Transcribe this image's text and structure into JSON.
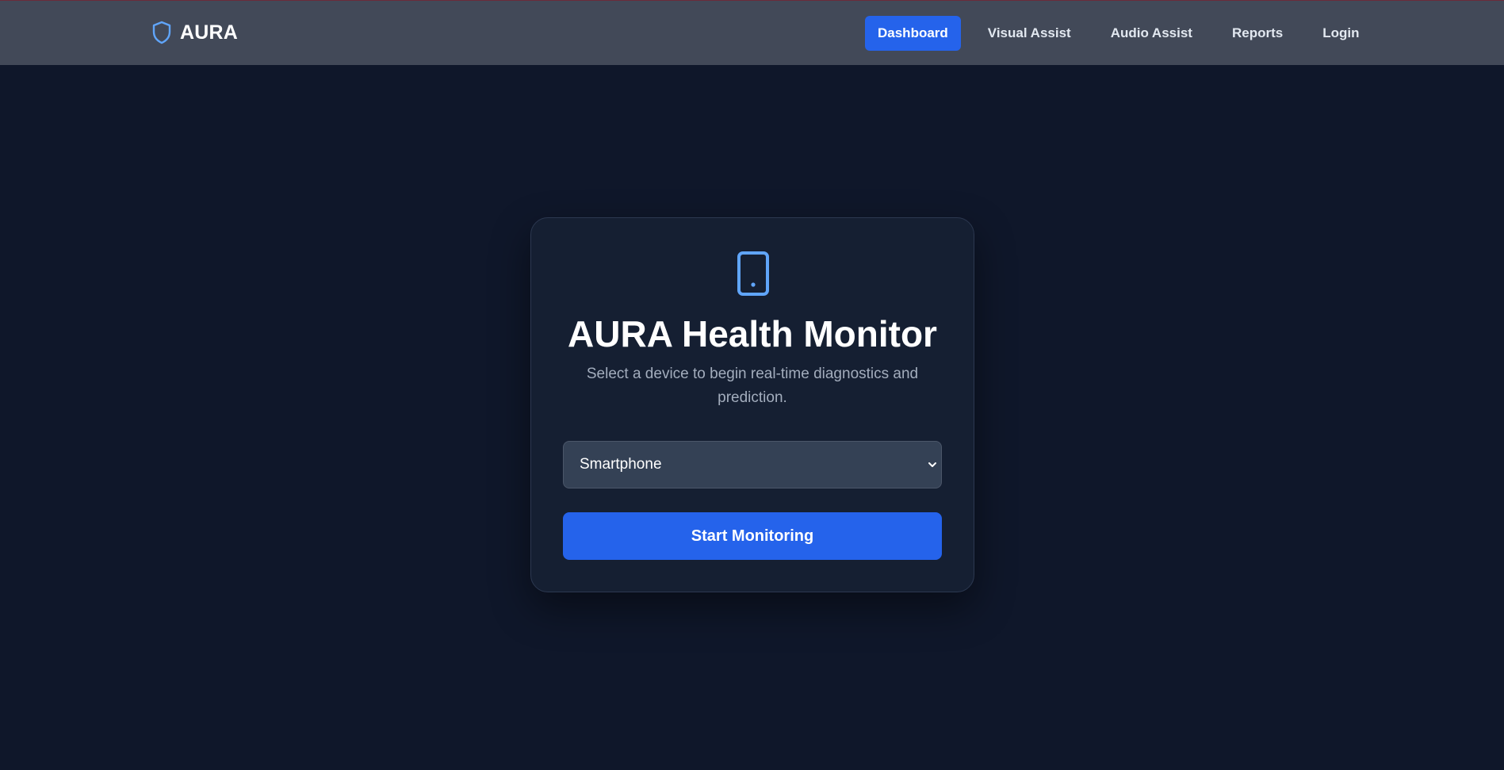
{
  "navbar": {
    "brand_name": "AURA",
    "brand_icon": "shield-icon",
    "links": [
      {
        "label": "Dashboard",
        "active": true
      },
      {
        "label": "Visual Assist",
        "active": false
      },
      {
        "label": "Audio Assist",
        "active": false
      },
      {
        "label": "Reports",
        "active": false
      },
      {
        "label": "Login",
        "active": false
      }
    ]
  },
  "card": {
    "icon": "smartphone-icon",
    "title": "AURA Health Monitor",
    "subtitle": "Select a device to begin real-time diagnostics and prediction.",
    "device_select": {
      "selected": "Smartphone"
    },
    "start_button_label": "Start Monitoring"
  },
  "colors": {
    "background": "#0f172a",
    "navbar": "#424958",
    "accent": "#2563eb",
    "icon_accent": "#60a5fa",
    "card": "#151f32"
  }
}
